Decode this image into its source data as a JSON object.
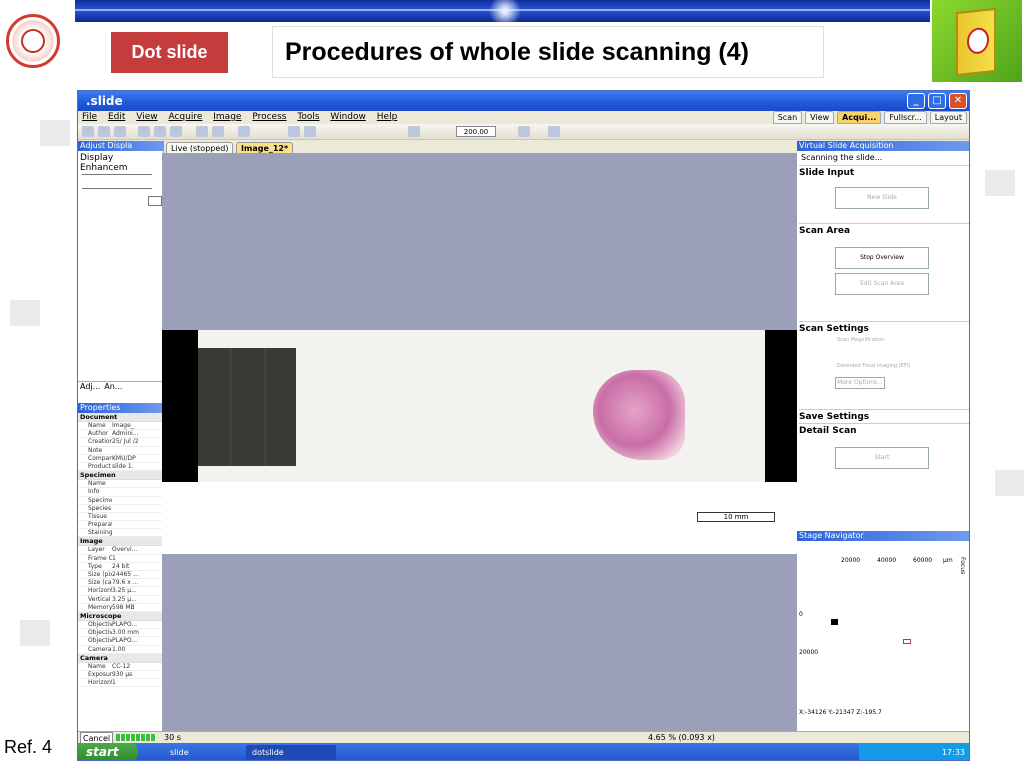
{
  "slide": {
    "tag": "Dot slide",
    "title": "Procedures of whole slide scanning (4)",
    "ref": "Ref. 4"
  },
  "app": {
    "title": ".slide",
    "menu": [
      "File",
      "Edit",
      "View",
      "Acquire",
      "Image",
      "Process",
      "Tools",
      "Window",
      "Help"
    ],
    "view_tabs": [
      "Scan",
      "View",
      "Acqui...",
      "Fullscr..."
    ],
    "layout_label": "Layout",
    "zoom_value": "200.00",
    "left_panel": {
      "header": "Adjust Displa",
      "title": "Display Enhancem",
      "tabs": [
        "Adj...",
        "An..."
      ]
    },
    "properties": {
      "header": "Properties",
      "groups": [
        {
          "name": "Document",
          "rows": [
            [
              "Name",
              "Image_"
            ],
            [
              "Author",
              "Admini..."
            ],
            [
              "Creation",
              "25/ Jul /2"
            ],
            [
              "Note",
              ""
            ],
            [
              "Company",
              "KMU/DP"
            ],
            [
              "Product ...",
              "slide 1."
            ]
          ]
        },
        {
          "name": "Specimen",
          "rows": [
            [
              "Name",
              ""
            ],
            [
              "Info",
              ""
            ],
            [
              "Specimen",
              ""
            ],
            [
              "Species",
              ""
            ],
            [
              "Tissue",
              ""
            ],
            [
              "Preparat...",
              ""
            ],
            [
              "Staining",
              ""
            ]
          ]
        },
        {
          "name": "Image",
          "rows": [
            [
              "Layer",
              "Overvi..."
            ],
            [
              "Frame C...",
              "1"
            ],
            [
              "Type",
              "24 bit"
            ],
            [
              "Size (pix...",
              "24465 ..."
            ],
            [
              "Size (cal...",
              "79.6 x ..."
            ],
            [
              "Horizont...",
              "3.25 µ..."
            ],
            [
              "Vertical ...",
              "3.25 µ..."
            ],
            [
              "Memory ...",
              "598 MB"
            ]
          ]
        },
        {
          "name": "Microscope",
          "rows": [
            [
              "Objectiv...",
              "PLAPO..."
            ],
            [
              "Objectiv...",
              "3.00 mm"
            ],
            [
              "Objectiv...",
              "PLAPO..."
            ],
            [
              "Camera a...",
              "1.00"
            ]
          ]
        },
        {
          "name": "Camera",
          "rows": [
            [
              "Name",
              "CC-12"
            ],
            [
              "Exposur...",
              "930 µs"
            ],
            [
              "Horizont...",
              "1"
            ]
          ]
        }
      ]
    },
    "doc_tabs": [
      "Live (stopped)",
      "Image_12*"
    ],
    "scale_bar": "10 mm",
    "status": {
      "cancel": "Cancel",
      "exposure": "30 s",
      "zoom": "4.65 % (0.093 x)"
    },
    "acquisition": {
      "header": "Virtual Slide Acquisition",
      "status": "Scanning the slide...",
      "sections": {
        "slide_input": "Slide Input",
        "scan_area": "Scan Area",
        "scan_settings": "Scan Settings",
        "save_settings": "Save Settings",
        "detail_scan": "Detail Scan"
      },
      "buttons": {
        "new_slide": "New Slide",
        "stop_overview": "Stop Overview",
        "edit_scan_area": "Edit Scan Area",
        "scan_magnification": "Scan Magnification",
        "efi": "Extended Focal Imaging (EFI)",
        "more_options": "More Options...",
        "start": "Start"
      }
    },
    "navigator": {
      "header": "Stage Navigator",
      "x_ticks": [
        "20000",
        "40000",
        "60000"
      ],
      "x_unit": "µm",
      "y_ticks": [
        "0",
        "20000"
      ],
      "focus": "Focus",
      "coords": "X:-34126  Y:-21347  Z:-195.7"
    },
    "taskbar": {
      "start": "start",
      "tasks": [
        "slide",
        "dotslide"
      ],
      "clock": "17:33"
    }
  }
}
